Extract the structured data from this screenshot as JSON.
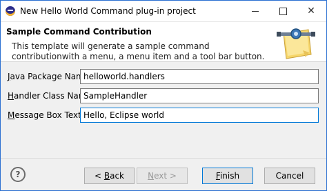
{
  "window": {
    "title": "New Hello World Command plug-in project",
    "minimize_label": "",
    "close_glyph": "✕"
  },
  "header": {
    "title": "Sample Command Contribution",
    "description": "This template will generate a sample command contributionwith a menu, a menu item and a tool bar button.",
    "banner_icon": "wizard-banner-icon"
  },
  "form": {
    "java_package": {
      "label_mnemonic": "J",
      "label_rest": "ava Package Name:",
      "value": "helloworld.handlers"
    },
    "handler_class": {
      "label_mnemonic": "H",
      "label_rest": "andler Class Name:",
      "value": "SampleHandler"
    },
    "message_box": {
      "label_mnemonic": "M",
      "label_rest": "essage Box Text:",
      "value": "Hello, Eclipse world"
    }
  },
  "footer": {
    "help": "?",
    "back": {
      "prefix": "< ",
      "mnemonic": "B",
      "rest": "ack"
    },
    "next": {
      "mnemonic": "N",
      "rest": "ext >"
    },
    "finish": {
      "mnemonic": "F",
      "rest": "inish"
    },
    "cancel": "Cancel"
  },
  "colors": {
    "focus": "#0078d7",
    "window_border": "#2a6fd1"
  }
}
